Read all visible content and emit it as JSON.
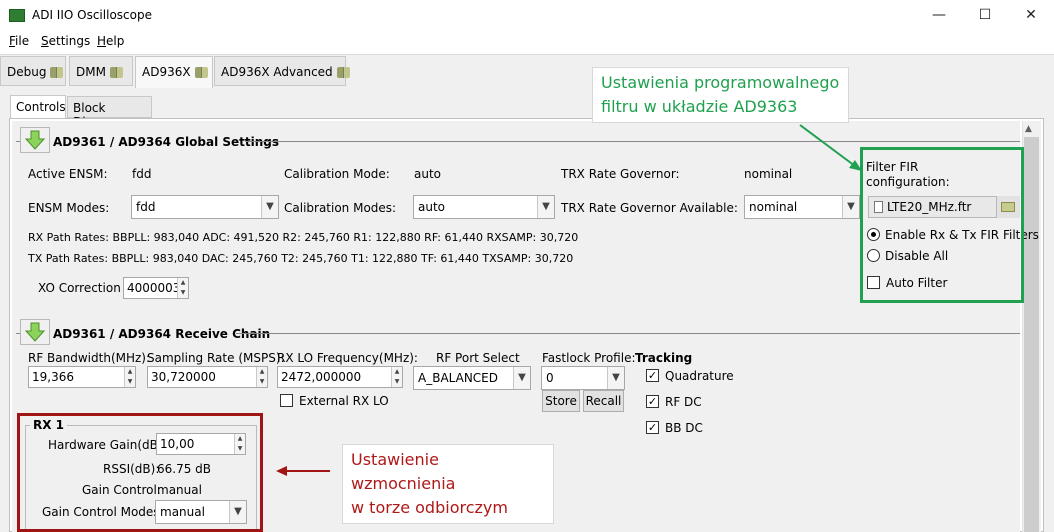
{
  "window": {
    "title": "ADI IIO Oscilloscope",
    "minimize": "—",
    "maximize": "☐",
    "close": "✕"
  },
  "menu": [
    {
      "u": "F",
      "rest": "ile"
    },
    {
      "u": "S",
      "rest": "ettings"
    },
    {
      "u": "H",
      "rest": "elp"
    }
  ],
  "tabs": [
    "Debug",
    "DMM",
    "AD936X",
    "AD936X Advanced"
  ],
  "subtabs": [
    "Controls",
    "Block Diagram"
  ],
  "global": {
    "title": "AD9361 / AD9364 Global Settings",
    "active_ensm_label": "Active ENSM:",
    "active_ensm": "fdd",
    "cal_mode_label": "Calibration Mode:",
    "cal_mode": "auto",
    "trx_gov_label": "TRX Rate Governor:",
    "trx_gov": "nominal",
    "ensm_modes_label": "ENSM Modes:",
    "ensm_modes": "fdd",
    "cal_modes_label": "Calibration Modes:",
    "cal_modes": "auto",
    "trx_avail_label": "TRX Rate Governor Available:",
    "trx_avail": "nominal",
    "rx_path": "RX Path Rates:  BBPLL: 983,040   ADC: 491,520   R2: 245,760   R1: 122,880   RF: 61,440   RXSAMP: 30,720",
    "tx_path": "TX Path Rates:  BBPLL: 983,040   DAC: 245,760   T2: 245,760   T1: 122,880   TF: 61,440   TXSAMP: 30,720",
    "xo_label": "XO Correction",
    "xo_value": "40000036"
  },
  "fir": {
    "label": "Filter FIR configuration:",
    "file": "LTE20_MHz.ftr",
    "opt_enable": "Enable Rx & Tx FIR Filters",
    "opt_disable": "Disable All",
    "auto_filter": "Auto Filter"
  },
  "rx": {
    "title": "AD9361 / AD9364 Receive Chain",
    "rf_bw_label": "RF Bandwidth(MHz):",
    "rf_bw": "19,366",
    "samp_label": "Sampling Rate (MSPS):",
    "samp": "30,720000",
    "lo_label": "RX LO Frequency(MHz):",
    "lo": "2472,000000",
    "port_label": "RF Port Select",
    "port": "A_BALANCED",
    "fastlock_label": "Fastlock Profile:",
    "fastlock": "0",
    "store": "Store",
    "recall": "Recall",
    "ext_lo": "External RX LO",
    "tracking_label": "Tracking",
    "quadrature": "Quadrature",
    "rf_dc": "RF DC",
    "bb_dc": "BB DC"
  },
  "rx1": {
    "title": "RX 1",
    "gain_label": "Hardware Gain(dB):",
    "gain": "10,00",
    "rssi_label": "RSSI(dB):",
    "rssi": "66.75 dB",
    "gc_label": "Gain Control:",
    "gc": "manual",
    "gcm_label": "Gain Control Modes:",
    "gcm": "manual"
  },
  "annotations": {
    "fir_note_1": "Ustawienia programowalnego",
    "fir_note_2": "filtru w układzie AD9363",
    "gain_note_1": "Ustawienie wzmocnienia",
    "gain_note_2": "w torze odbiorczym"
  },
  "colors": {
    "annotation_green": "#1fa14f",
    "annotation_red": "#a11414"
  }
}
